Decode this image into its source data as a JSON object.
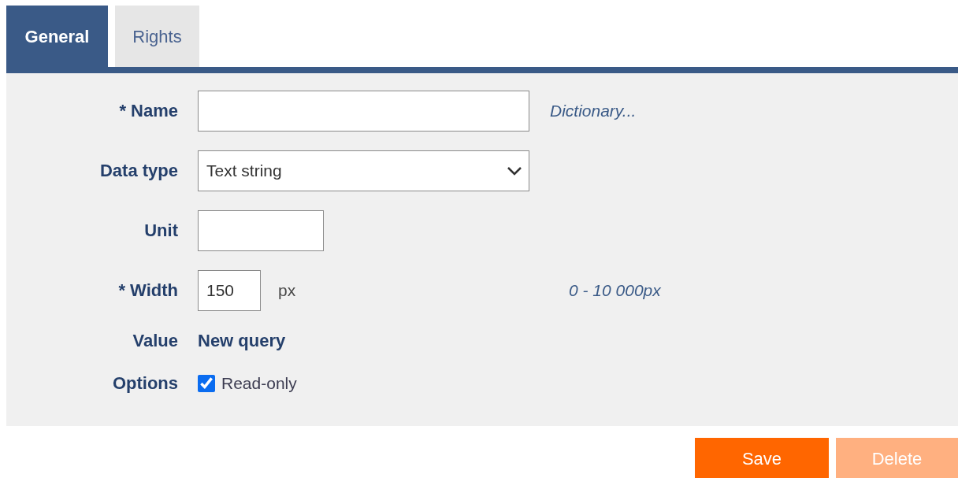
{
  "tabs": [
    {
      "label": "General",
      "selected": true
    },
    {
      "label": "Rights",
      "selected": false
    }
  ],
  "fields": [
    {
      "kind": "text",
      "label": "* Name",
      "hint": "Dictionary..."
    },
    {
      "kind": "select",
      "label": "Data type",
      "value": "Text string"
    },
    {
      "kind": "short",
      "label": "Unit"
    },
    {
      "kind": "number",
      "label": "* Width",
      "value": "150",
      "unit": "px",
      "hint": "0 - 10 000px"
    },
    {
      "kind": "static",
      "label": "Value",
      "value": "New query"
    },
    {
      "kind": "checkbox",
      "label": "Options",
      "text": "Read-only",
      "checked": true
    }
  ],
  "buttons": [
    {
      "label": "Save",
      "disabled": false
    },
    {
      "label": "Delete",
      "disabled": true
    }
  ]
}
